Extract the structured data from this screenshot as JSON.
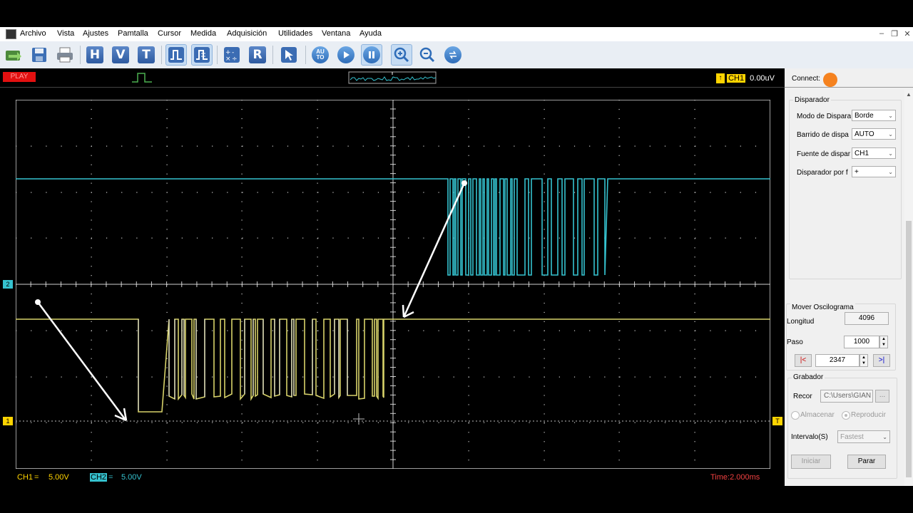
{
  "menu": {
    "items": [
      "Archivo",
      "Vista",
      "Ajustes",
      "Pamtalla",
      "Cursor",
      "Medida",
      "Adquisición",
      "Utilidades",
      "Ventana",
      "Ayuda"
    ]
  },
  "toolbar": {
    "icons": [
      "open-icon",
      "save-icon",
      "print-icon",
      "horizontal-icon",
      "vertical-icon",
      "trigger-icon",
      "channel1-wave-icon",
      "channel2-wave-icon",
      "math-icon",
      "reference-icon",
      "cursor-icon",
      "auto-icon",
      "play-icon",
      "pause-icon",
      "zoom-in-icon",
      "zoom-out-icon",
      "refresh-icon"
    ],
    "h_label": "H",
    "v_label": "V",
    "t_label": "T",
    "r_label": "R",
    "auto_label": "AU TO"
  },
  "status": {
    "play_label": "PLAY",
    "trigger_channel": "CH1",
    "trigger_level": "0.00uV"
  },
  "connect": {
    "label": "Connect:",
    "status_color": "#f5821f"
  },
  "disparador": {
    "title": "Disparador",
    "mode_label": "Modo de Dispara",
    "mode_value": "Borde",
    "sweep_label": "Barrido de dispa",
    "sweep_value": "AUTO",
    "source_label": "Fuente de dispar",
    "source_value": "CH1",
    "slope_label": "Disparador por f",
    "slope_value": "+"
  },
  "mover": {
    "title": "Mover Oscilograma",
    "length_label": "Longitud",
    "length_value": "4096",
    "step_label": "Paso",
    "step_value": "1000",
    "first_label": "|<",
    "position_value": "2347",
    "last_label": ">|"
  },
  "grabador": {
    "title": "Grabador",
    "record_label": "Recor",
    "path_value": "C:\\Users\\GIAN",
    "browse_label": "...",
    "store_label": "Almacenar",
    "play_label": "Reproducir",
    "interval_label": "Intervalo(S)",
    "interval_value": "Fastest",
    "start_label": "Iniciar",
    "stop_label": "Parar"
  },
  "bottom": {
    "ch1_label": "CH1",
    "ch1_coupling": "=",
    "ch1_scale": "5.00V",
    "ch2_label": "CH2",
    "ch2_coupling": "=",
    "ch2_scale": "5.00V",
    "time_label": "Time:2.000ms"
  },
  "markers": {
    "ch1": "1",
    "ch2": "2",
    "trigger": "T"
  },
  "colors": {
    "ch1": "#d8d36a",
    "ch2": "#35c2cf",
    "grid": "#cfcfcf",
    "arrow": "#ffffff",
    "connect": "#f5821f"
  }
}
